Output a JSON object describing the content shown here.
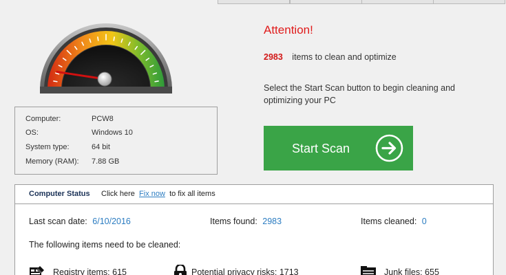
{
  "attention": {
    "title": "Attention!",
    "item_count": "2983",
    "items_text": "items to clean and optimize",
    "instructions": "Select the Start Scan button to begin cleaning and optimizing your PC"
  },
  "start_scan": {
    "label": "Start Scan",
    "icon": "arrow-right-circle-icon"
  },
  "gauge": {
    "level": 0.05,
    "colors": [
      "#d32a12",
      "#f08a1a",
      "#f2c617",
      "#7dbb2c",
      "#2e9a3a"
    ]
  },
  "system_info": [
    {
      "label": "Computer:",
      "value": "PCW8"
    },
    {
      "label": "OS:",
      "value": "Windows 10"
    },
    {
      "label": "System type:",
      "value": "64 bit"
    },
    {
      "label": "Memory (RAM):",
      "value": "7.88 GB"
    }
  ],
  "computer_status": {
    "title": "Computer Status",
    "click_prefix": "Click here",
    "fix_link": "Fix now",
    "click_suffix": "to fix all items",
    "last_scan_label": "Last scan date:",
    "last_scan_value": "6/10/2016",
    "items_found_label": "Items found:",
    "items_found_value": "2983",
    "items_cleaned_label": "Items cleaned:",
    "items_cleaned_value": "0",
    "need_clean_text": "The following items need to be cleaned:",
    "categories": [
      {
        "text": "Registry items:  615",
        "icon": "registry-icon"
      },
      {
        "text": "Potential privacy risks:  1713",
        "icon": "lock-icon"
      },
      {
        "text": "Junk files:  655",
        "icon": "junk-files-icon"
      }
    ]
  },
  "colors": {
    "accent_green": "#3aa447",
    "alert_red": "#e01b1b",
    "link_blue": "#2b7cc1"
  }
}
